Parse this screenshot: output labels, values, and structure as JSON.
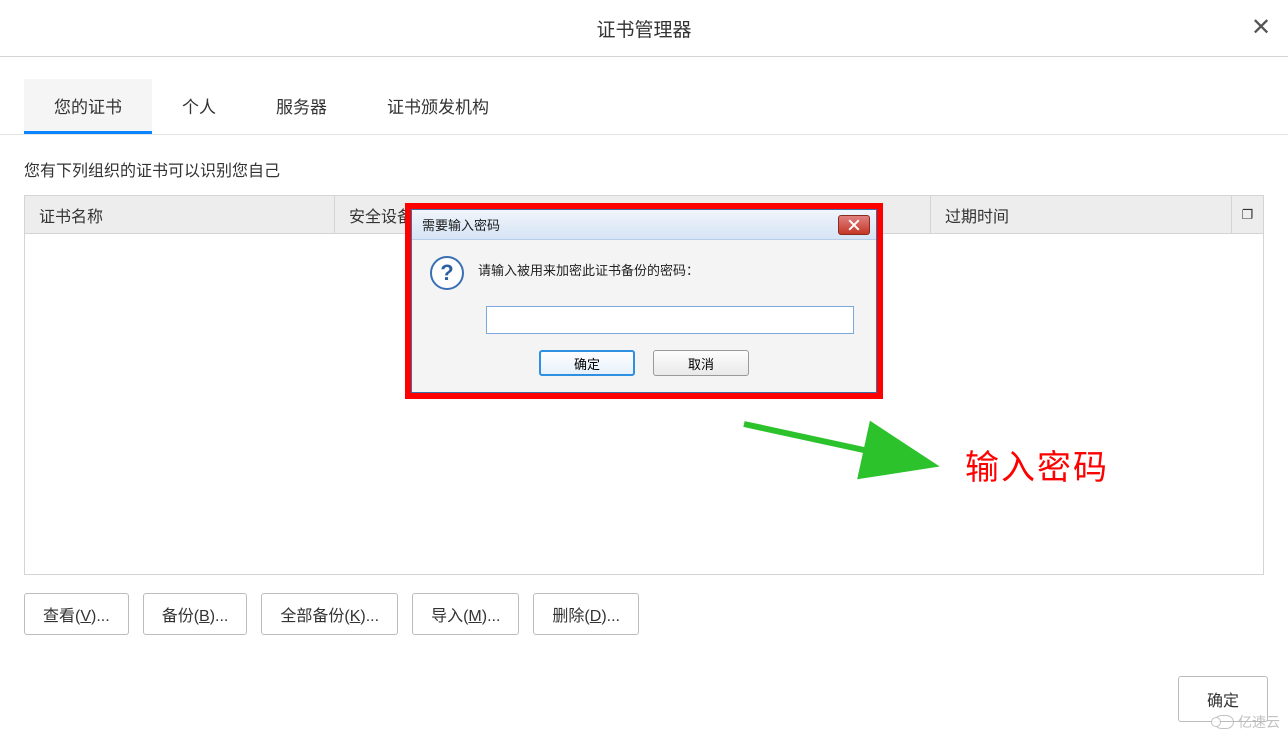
{
  "header": {
    "title": "证书管理器",
    "close_glyph": "✕"
  },
  "tabs": [
    {
      "label": "您的证书",
      "active": true
    },
    {
      "label": "个人",
      "active": false
    },
    {
      "label": "服务器",
      "active": false
    },
    {
      "label": "证书颁发机构",
      "active": false
    }
  ],
  "description": "您有下列组织的证书可以识别您自己",
  "table": {
    "columns": {
      "name": "证书名称",
      "device": "安全设备",
      "expires": "过期时间"
    },
    "expand_glyph": "❐"
  },
  "actions": {
    "view": {
      "prefix": "查看(",
      "mnemonic": "V",
      "suffix": ")..."
    },
    "backup": {
      "prefix": "备份(",
      "mnemonic": "B",
      "suffix": ")..."
    },
    "backup_all": {
      "prefix": "全部备份(",
      "mnemonic": "K",
      "suffix": ")..."
    },
    "import": {
      "prefix": "导入(",
      "mnemonic": "M",
      "suffix": ")..."
    },
    "delete": {
      "prefix": "删除(",
      "mnemonic": "D",
      "suffix": ")..."
    }
  },
  "footer": {
    "ok_label": "确定"
  },
  "dialog": {
    "title": "需要输入密码",
    "message": "请输入被用来加密此证书备份的密码：",
    "question_glyph": "?",
    "input_value": "",
    "ok_label": "确定",
    "cancel_label": "取消"
  },
  "annotation": {
    "text": "输入密码"
  },
  "watermark": {
    "text": "亿速云"
  }
}
